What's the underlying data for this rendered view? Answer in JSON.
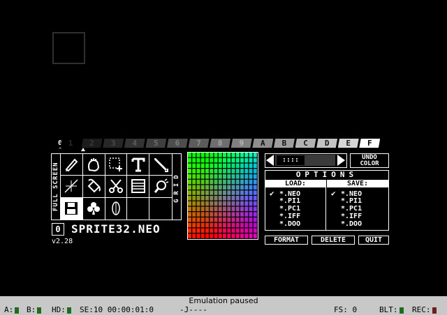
{
  "palette": {
    "zero_label": "0",
    "tabs": [
      {
        "label": "1",
        "bg": "#000000",
        "fg": "#2a2a2a"
      },
      {
        "label": "2",
        "bg": "#1c1c1c",
        "fg": "#3a3a3a"
      },
      {
        "label": "3",
        "bg": "#272727",
        "fg": "#484848"
      },
      {
        "label": "4",
        "bg": "#333333",
        "fg": "#5c5c5c"
      },
      {
        "label": "5",
        "bg": "#3f3f3f",
        "fg": "#6e6e6e"
      },
      {
        "label": "6",
        "bg": "#4d4d4d",
        "fg": "#7e7e7e"
      },
      {
        "label": "7",
        "bg": "#5c5c5c",
        "fg": "#909090"
      },
      {
        "label": "8",
        "bg": "#6e6e6e",
        "fg": "#a5a5a5"
      },
      {
        "label": "9",
        "bg": "#808080",
        "fg": "#b5b5b5"
      },
      {
        "label": "A",
        "bg": "#8f8f8f",
        "fg": "#111111"
      },
      {
        "label": "B",
        "bg": "#9e9e9e",
        "fg": "#111111"
      },
      {
        "label": "C",
        "bg": "#b2b2b2",
        "fg": "#111111"
      },
      {
        "label": "D",
        "bg": "#c4c4c4",
        "fg": "#111111"
      },
      {
        "label": "E",
        "bg": "#d6d6d6",
        "fg": "#111111"
      },
      {
        "label": "F",
        "bg": "#ffffff",
        "fg": "#000000"
      }
    ]
  },
  "side_labels": {
    "left": "FULL SCREEN",
    "right": "GRID"
  },
  "tools": [
    {
      "icon": "pencil-icon",
      "selected": false
    },
    {
      "icon": "hand-icon",
      "selected": false
    },
    {
      "icon": "selection-icon",
      "selected": false
    },
    {
      "icon": "text-icon",
      "selected": false
    },
    {
      "icon": "brush-icon",
      "selected": false
    },
    {
      "icon": "line-icon",
      "selected": false
    },
    {
      "icon": "paint-bucket-icon",
      "selected": false
    },
    {
      "icon": "scissors-icon",
      "selected": false
    },
    {
      "icon": "window-icon",
      "selected": false
    },
    {
      "icon": "spray-icon",
      "selected": false
    },
    {
      "icon": "floppy-disk-icon",
      "selected": true
    },
    {
      "icon": "club-icon",
      "selected": false
    },
    {
      "icon": "lens-icon",
      "selected": false
    },
    {
      "icon": "",
      "selected": false
    },
    {
      "icon": "",
      "selected": false
    }
  ],
  "layer_badge": "0",
  "filename": "SPRITE32.NEO",
  "version": "v2.28",
  "nav_thumb": "::::",
  "undo": {
    "line1": "UNDO",
    "line2": "COLOR"
  },
  "options": {
    "title": "OPTIONS",
    "load_header": "LOAD:",
    "save_header": "SAVE:",
    "load_items": [
      "*.NEO",
      "*.PI1",
      "*.PC1",
      "*.IFF",
      "*.DOO"
    ],
    "save_items": [
      "*.NEO",
      "*.PI1",
      "*.PC1",
      "*.IFF",
      "*.DOO"
    ],
    "load_checked": 0,
    "save_checked": 0,
    "check_glyph": "✔"
  },
  "buttons": {
    "format": "FORMAT",
    "delete": "DELETE",
    "quit": "QUIT"
  },
  "status": {
    "title": "Emulation paused",
    "a_label": "A:",
    "b_label": "B:",
    "hd_label": "HD:",
    "se_text": "SE:10 00:00:01:0",
    "joy_text": "-J----",
    "fs_text": "FS: 0",
    "blt_label": "BLT:",
    "rec_label": "REC:"
  }
}
